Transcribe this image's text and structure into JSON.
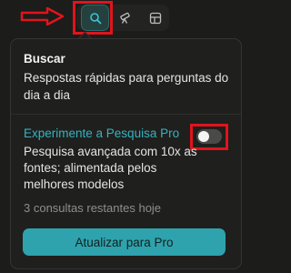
{
  "toolbar": {
    "modes": [
      {
        "icon": "search-icon",
        "active": true
      },
      {
        "icon": "telescope-icon",
        "active": false
      },
      {
        "icon": "labs-grid-icon",
        "active": false
      }
    ],
    "accent_color": "#2b6b6a",
    "highlight_color": "#e0141c"
  },
  "popover": {
    "title": "Buscar",
    "description": "Respostas rápidas para perguntas do dia a dia",
    "pro": {
      "title": "Experimente a Pesquisa Pro",
      "toggle_on": false,
      "description": "Pesquisa avançada com 10x as fontes; alimentada pelos melhores modelos",
      "remaining": "3 consultas restantes hoje"
    },
    "upgrade_label": "Atualizar para Pro",
    "button_color": "#2ea3ad",
    "pro_title_color": "#34b3c0"
  }
}
